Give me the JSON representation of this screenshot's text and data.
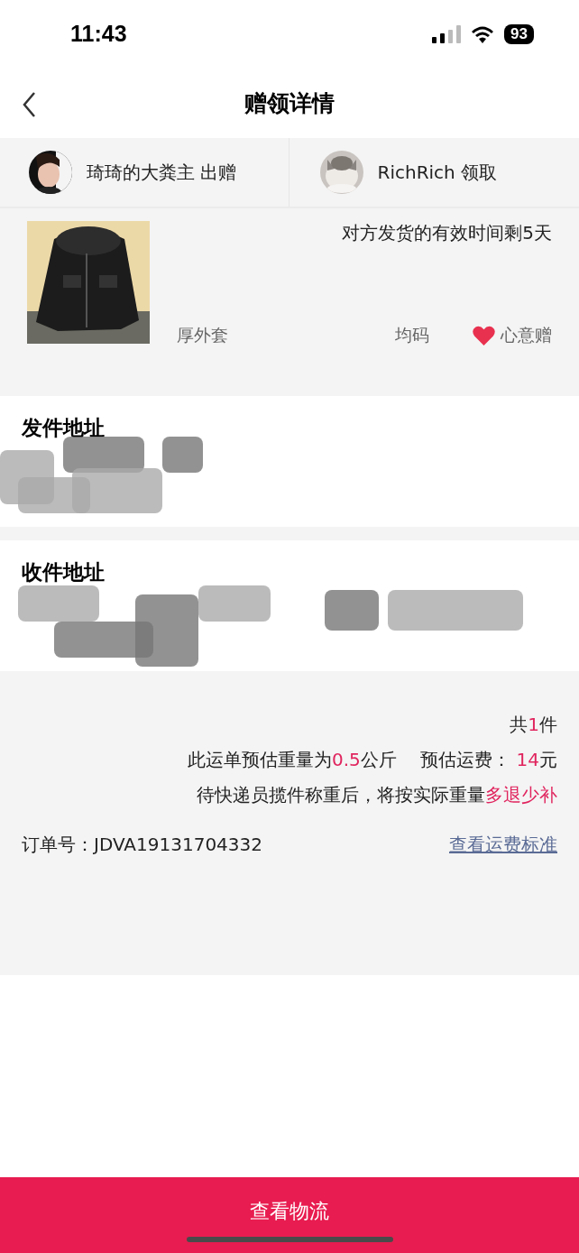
{
  "status_bar": {
    "time": "11:43",
    "battery": "93"
  },
  "nav": {
    "title": "赠领详情"
  },
  "parties": [
    {
      "name": "琦琦的大粪主 出赠",
      "kind": "person"
    },
    {
      "name": "RichRich 领取",
      "kind": "cat"
    }
  ],
  "item": {
    "deadline": "对方发货的有效时间剩5天",
    "name": "厚外套",
    "size": "均码",
    "tag": "心意赠"
  },
  "addresses": [
    {
      "title": "发件地址"
    },
    {
      "title": "收件地址"
    }
  ],
  "summary": {
    "lines": [
      [
        {
          "text": "共",
          "highlight": false
        },
        {
          "text": "1",
          "highlight": true
        },
        {
          "text": "件",
          "highlight": false
        }
      ],
      [
        {
          "text": "此运单预估重量为",
          "highlight": false
        },
        {
          "text": "0.5",
          "highlight": true
        },
        {
          "text": "公斤　 预估运费： ",
          "highlight": false
        },
        {
          "text": "14",
          "highlight": true
        },
        {
          "text": "元",
          "highlight": false
        }
      ],
      [
        {
          "text": "待快递员揽件称重后，将按实际重量",
          "highlight": false
        },
        {
          "text": "多退少补",
          "highlight": true
        }
      ]
    ],
    "order_number": "订单号：JDVA19131704332",
    "link": "查看运费标准"
  },
  "bottom_button": "查看物流"
}
